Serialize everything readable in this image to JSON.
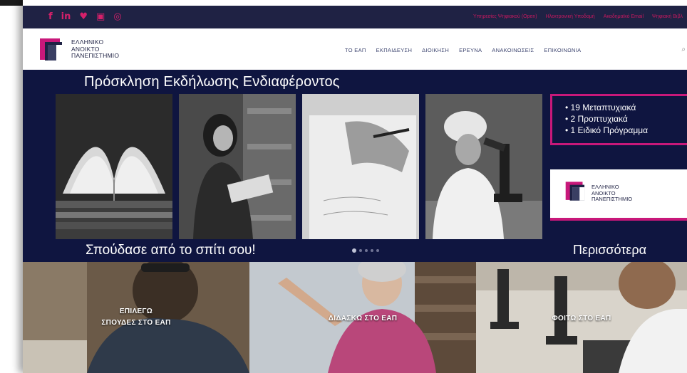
{
  "social": {
    "icons": [
      "f",
      "in",
      "♥",
      "▣",
      "◎"
    ],
    "icon_names": [
      "facebook-icon",
      "linkedin-icon",
      "twitter-icon",
      "youtube-icon",
      "instagram-icon"
    ]
  },
  "top_links": [
    "Υπηρεσίες Ψηφιακού (Open)",
    "Ηλεκτρονική Υποδομή",
    "Ακαδημαϊκό Email",
    "Ψηφιακή Βιβλ"
  ],
  "logo": {
    "line1": "ΕΛΛΗΝΙΚΟ",
    "line2": "ΑΝΟΙΚΤΟ",
    "line3": "ΠΑΝΕΠΙΣΤΗΜΙΟ"
  },
  "nav": [
    "ΤΟ ΕΑΠ",
    "ΕΚΠΑΙΔΕΥΣΗ",
    "ΔΙΟΙΚΗΣΗ",
    "ΕΡΕΥΝΑ",
    "ΑΝΑΚΟΙΝΩΣΕΙΣ",
    "ΕΠΙΚΟΙΝΩΝΙΑ"
  ],
  "search_icon": "⌕",
  "banner": {
    "title": "Πρόσκληση Εκδήλωσης Ενδιαφέροντος",
    "features": [
      "• 19 Μεταπτυχιακά",
      "• 2 Προπτυχιακά",
      "• 1 Ειδικό Πρόγραμμα"
    ],
    "slogan": "Σπούδασε από το σπίτι σου!",
    "more": "Περισσότερα",
    "card_logo": {
      "line1": "ΕΛΛΗΝΙΚΟ",
      "line2": "ΑΝΟΙΚΤΟ",
      "line3": "ΠΑΝΕΠΙΣΤΗΜΙΟ"
    },
    "slide_count": 5,
    "active_slide": 1
  },
  "tiles": [
    {
      "line1": "ΕΠΙΛΕΓΩ",
      "line2": "ΣΠΟΥΔΕΣ ΣΤΟ ΕΑΠ"
    },
    {
      "line1": "ΔΙΔΑΣΚΩ ΣΤΟ ΕΑΠ",
      "line2": ""
    },
    {
      "line1": "ΦΟΙΤΩ ΣΤΟ ΕΑΠ",
      "line2": ""
    }
  ],
  "colors": {
    "navy": "#0f1540",
    "topbar": "#1f2244",
    "accent": "#c8187a",
    "nav_text": "#3e4670"
  }
}
